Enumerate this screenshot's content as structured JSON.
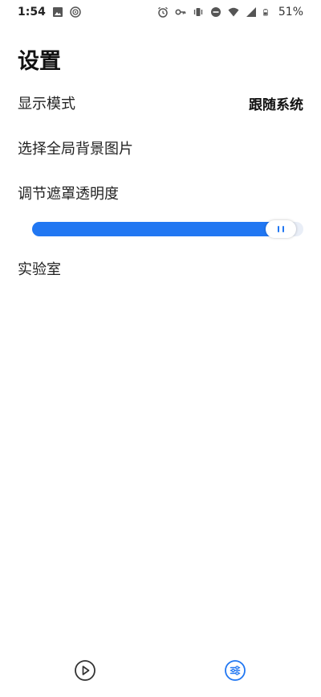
{
  "status_bar": {
    "time": "1:54",
    "battery": "51%"
  },
  "page": {
    "title": "设置"
  },
  "settings": {
    "display_mode": {
      "label": "显示模式",
      "value": "跟随系统"
    },
    "background_image": {
      "label": "选择全局背景图片"
    },
    "mask_opacity": {
      "label": "调节遮罩透明度",
      "value_fraction": 0.97
    },
    "lab": {
      "label": "实验室"
    }
  },
  "bottom_nav": {
    "items": [
      {
        "icon": "play-circle-icon",
        "active": false
      },
      {
        "icon": "settings-sliders-icon",
        "active": true
      }
    ]
  },
  "colors": {
    "accent": "#2177f2",
    "inactive_icon": "#333333"
  }
}
